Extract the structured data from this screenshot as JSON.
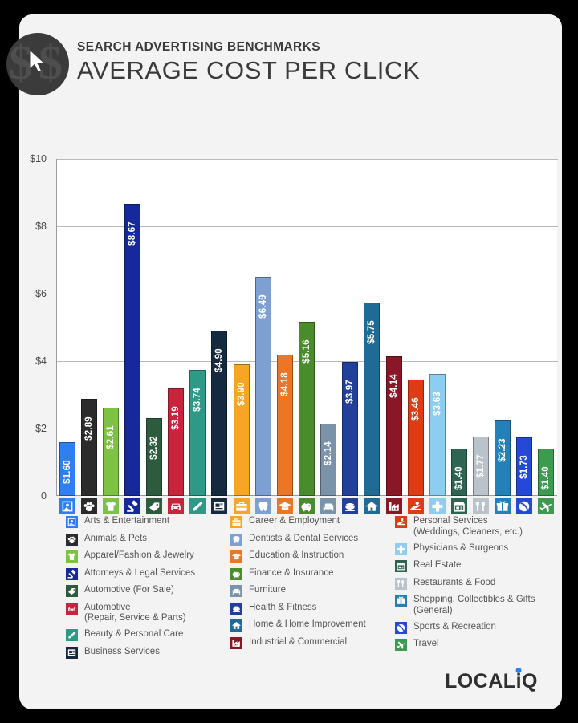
{
  "header": {
    "kicker": "SEARCH ADVERTISING BENCHMARKS",
    "title": "AVERAGE COST PER CLICK",
    "badge_icon": "dollar-cursor-icon"
  },
  "brand": {
    "logo_main": "LOCAL",
    "logo_i": "i",
    "logo_q": "Q",
    "accent_color": "#2f7ff0"
  },
  "chart_data": {
    "type": "bar",
    "title": "AVERAGE COST PER CLICK",
    "subtitle": "SEARCH ADVERTISING BENCHMARKS",
    "xlabel": "",
    "ylabel": "",
    "ylim": [
      0,
      10
    ],
    "grid": true,
    "legend_position": "bottom",
    "ytick_labels": [
      "$10",
      "$8",
      "$6",
      "$4",
      "$2",
      "0"
    ],
    "ytick_values": [
      10,
      8,
      6,
      4,
      2,
      0
    ],
    "categories": [
      "Arts & Entertainment",
      "Animals & Pets",
      "Apparel/Fashion & Jewelry",
      "Attorneys & Legal Services",
      "Automotive (For Sale)",
      "Automotive (Repair, Service & Parts)",
      "Beauty & Personal Care",
      "Business Services",
      "Career & Employment",
      "Dentists & Dental Services",
      "Education & Instruction",
      "Finance & Insurance",
      "Furniture",
      "Health & Fitness",
      "Home & Home Improvement",
      "Industrial & Commercial",
      "Personal Services (Weddings, Cleaners, etc.)",
      "Physicians & Surgeons",
      "Real Estate",
      "Restaurants & Food",
      "Shopping, Collectibles & Gifts (General)",
      "Sports & Recreation",
      "Travel"
    ],
    "values": [
      1.6,
      2.89,
      2.61,
      8.67,
      2.32,
      3.19,
      3.74,
      4.9,
      3.9,
      6.49,
      4.18,
      5.16,
      2.14,
      3.97,
      5.75,
      4.14,
      3.46,
      3.63,
      1.4,
      1.77,
      2.23,
      1.73,
      1.4
    ],
    "value_labels": [
      "$1.60",
      "$2.89",
      "$2.61",
      "$8.67",
      "$2.32",
      "$3.19",
      "$3.74",
      "$4.90",
      "$3.90",
      "$6.49",
      "$4.18",
      "$5.16",
      "$2.14",
      "$3.97",
      "$5.75",
      "$4.14",
      "$3.46",
      "$3.63",
      "$1.40",
      "$1.77",
      "$2.23",
      "$1.73",
      "$1.40"
    ],
    "colors": [
      "#2f7ff0",
      "#2b2b2b",
      "#7dc242",
      "#16299b",
      "#2d5b3e",
      "#c8243c",
      "#2e9987",
      "#15293f",
      "#f5a623",
      "#7d9fd1",
      "#ec7623",
      "#4a8b2c",
      "#7b93a8",
      "#22409a",
      "#1f6b96",
      "#8a1726",
      "#e03c14",
      "#8ccdf0",
      "#2d6552",
      "#b9c3c9",
      "#2480b8",
      "#2449d8",
      "#3d9b4f"
    ],
    "icons": [
      "picture-icon",
      "paw-icon",
      "tshirt-icon",
      "gavel-icon",
      "car-tag-icon",
      "car-repair-icon",
      "brush-icon",
      "document-icon",
      "briefcase-icon",
      "tooth-icon",
      "graduation-cap-icon",
      "piggy-bank-icon",
      "sofa-icon",
      "dumbbell-icon",
      "house-icon",
      "factory-icon",
      "personal-services-icon",
      "medical-cross-icon",
      "storefront-icon",
      "cutlery-icon",
      "gift-icon",
      "ball-icon",
      "airplane-icon"
    ]
  },
  "legend": {
    "columns": [
      {
        "items": [
          {
            "label": "Arts & Entertainment",
            "sub": "",
            "color": "#2f7ff0",
            "icon": "picture-icon"
          },
          {
            "label": "Animals & Pets",
            "sub": "",
            "color": "#2b2b2b",
            "icon": "paw-icon"
          },
          {
            "label": "Apparel/Fashion & Jewelry",
            "sub": "",
            "color": "#7dc242",
            "icon": "tshirt-icon"
          },
          {
            "label": "Attorneys & Legal Services",
            "sub": "",
            "color": "#16299b",
            "icon": "gavel-icon"
          },
          {
            "label": "Automotive (For Sale)",
            "sub": "",
            "color": "#2d5b3e",
            "icon": "car-tag-icon"
          },
          {
            "label": "Automotive",
            "sub": "(Repair, Service & Parts)",
            "color": "#c8243c",
            "icon": "car-repair-icon"
          },
          {
            "label": "Beauty & Personal Care",
            "sub": "",
            "color": "#2e9987",
            "icon": "brush-icon"
          },
          {
            "label": "Business Services",
            "sub": "",
            "color": "#15293f",
            "icon": "document-icon"
          }
        ]
      },
      {
        "items": [
          {
            "label": "Career & Employment",
            "sub": "",
            "color": "#f5a623",
            "icon": "briefcase-icon"
          },
          {
            "label": "Dentists & Dental Services",
            "sub": "",
            "color": "#7d9fd1",
            "icon": "tooth-icon"
          },
          {
            "label": "Education & Instruction",
            "sub": "",
            "color": "#ec7623",
            "icon": "graduation-cap-icon"
          },
          {
            "label": "Finance & Insurance",
            "sub": "",
            "color": "#4a8b2c",
            "icon": "piggy-bank-icon"
          },
          {
            "label": "Furniture",
            "sub": "",
            "color": "#7b93a8",
            "icon": "sofa-icon"
          },
          {
            "label": "Health & Fitness",
            "sub": "",
            "color": "#22409a",
            "icon": "dumbbell-icon"
          },
          {
            "label": "Home & Home Improvement",
            "sub": "",
            "color": "#1f6b96",
            "icon": "house-icon"
          },
          {
            "label": "Industrial & Commercial",
            "sub": "",
            "color": "#8a1726",
            "icon": "factory-icon"
          }
        ]
      },
      {
        "items": [
          {
            "label": "Personal Services",
            "sub": "(Weddings, Cleaners, etc.)",
            "color": "#e03c14",
            "icon": "personal-services-icon"
          },
          {
            "label": "Physicians & Surgeons",
            "sub": "",
            "color": "#8ccdf0",
            "icon": "medical-cross-icon"
          },
          {
            "label": "Real Estate",
            "sub": "",
            "color": "#2d6552",
            "icon": "storefront-icon"
          },
          {
            "label": "Restaurants & Food",
            "sub": "",
            "color": "#b9c3c9",
            "icon": "cutlery-icon"
          },
          {
            "label": "Shopping, Collectibles & Gifts",
            "sub": "(General)",
            "color": "#2480b8",
            "icon": "gift-icon"
          },
          {
            "label": "Sports & Recreation",
            "sub": "",
            "color": "#2449d8",
            "icon": "ball-icon"
          },
          {
            "label": "Travel",
            "sub": "",
            "color": "#3d9b4f",
            "icon": "airplane-icon"
          }
        ]
      }
    ]
  }
}
